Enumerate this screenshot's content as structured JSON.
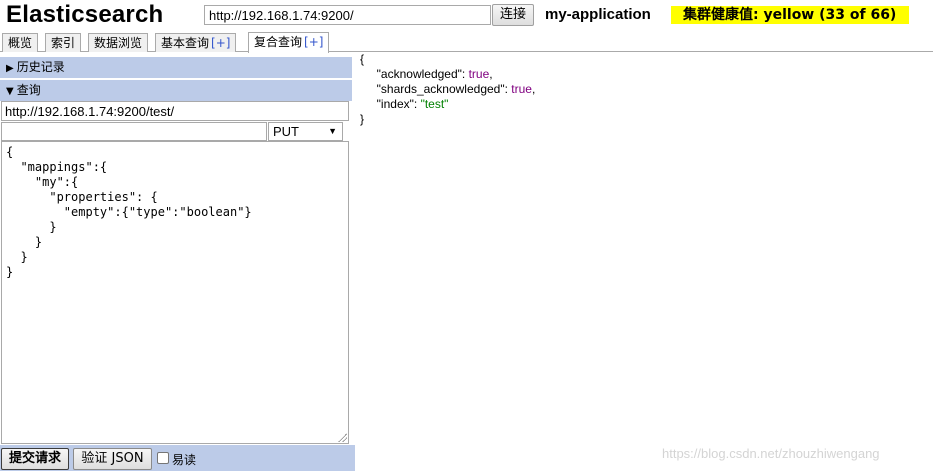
{
  "header": {
    "brand": "Elasticsearch",
    "url": "http://192.168.1.74:9200/",
    "connect_label": "连接",
    "cluster_name": "my-application",
    "health_text": "集群健康值: yellow (33 of 66)",
    "health_color": "#ffff00"
  },
  "tabs": [
    {
      "label": "概览",
      "plus": ""
    },
    {
      "label": "索引",
      "plus": ""
    },
    {
      "label": "数据浏览",
      "plus": ""
    },
    {
      "label": "基本查询",
      "plus": "[+]"
    },
    {
      "label": "复合查询",
      "plus": "[+]"
    }
  ],
  "left": {
    "history_label": "历史记录",
    "query_label": "查询",
    "query_url": "http://192.168.1.74:9200/test/",
    "path_value": "",
    "method": "PUT",
    "body": "{\n  \"mappings\":{\n    \"my\":{\n      \"properties\": {\n        \"empty\":{\"type\":\"boolean\"}\n      }\n    }\n  }\n}",
    "submit_label": "提交请求",
    "validate_label": "验证 JSON",
    "easy_read_label": "易读"
  },
  "response": {
    "open": "{",
    "close": "}",
    "lines": [
      {
        "key": "\"acknowledged\"",
        "sep": ": ",
        "value": "true",
        "type": "bool",
        "comma": ","
      },
      {
        "key": "\"shards_acknowledged\"",
        "sep": ": ",
        "value": "true",
        "type": "bool",
        "comma": ","
      },
      {
        "key": "\"index\"",
        "sep": ": ",
        "value": "\"test\"",
        "type": "str",
        "comma": ""
      }
    ]
  },
  "watermark": "https://blog.csdn.net/zhouzhiwengang",
  "colors": {
    "section_bar": "#bccbe8",
    "bool": "#800080",
    "string": "#008000"
  }
}
